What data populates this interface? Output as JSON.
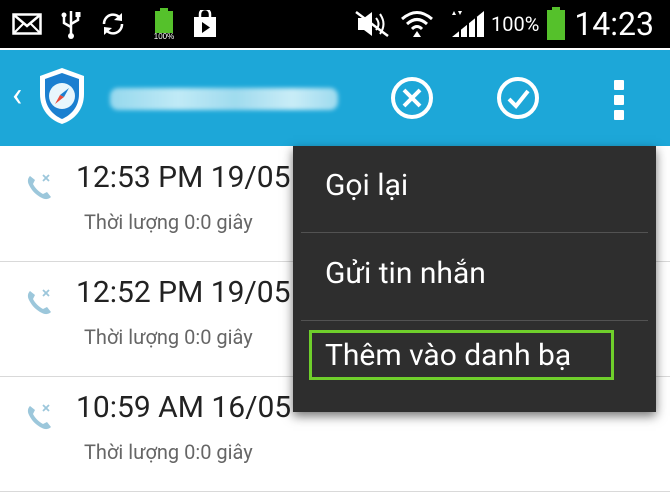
{
  "status_bar": {
    "time": "14:23",
    "battery_percent": "100%",
    "notification_battery_label": "100%",
    "icons": [
      "mail-icon",
      "usb-icon",
      "sync-icon",
      "battery-charged-icon",
      "store-bag-icon",
      "mute-icon",
      "wifi-icon",
      "signal-icon",
      "battery-icon"
    ]
  },
  "action_bar": {
    "app_icon": "shield-compass-icon",
    "buttons": [
      "cancel-icon",
      "confirm-check-icon",
      "overflow-menu-icon"
    ]
  },
  "call_log": [
    {
      "time": "12:53 PM 19/05",
      "duration": "Thời lượng 0:0 giây"
    },
    {
      "time": "12:52 PM 19/05",
      "duration": "Thời lượng 0:0 giây"
    },
    {
      "time": "10:59 AM 16/05",
      "duration": "Thời lượng 0:0 giây"
    }
  ],
  "menu": {
    "items": [
      {
        "label": "Gọi lại"
      },
      {
        "label": "Gửi tin nhắn"
      },
      {
        "label": "Thêm vào danh bạ"
      }
    ]
  },
  "colors": {
    "action_bar": "#1da7d8",
    "menu_bg": "#2e2e2e",
    "highlight": "#6fcf2b",
    "status_bar": "#000000"
  }
}
